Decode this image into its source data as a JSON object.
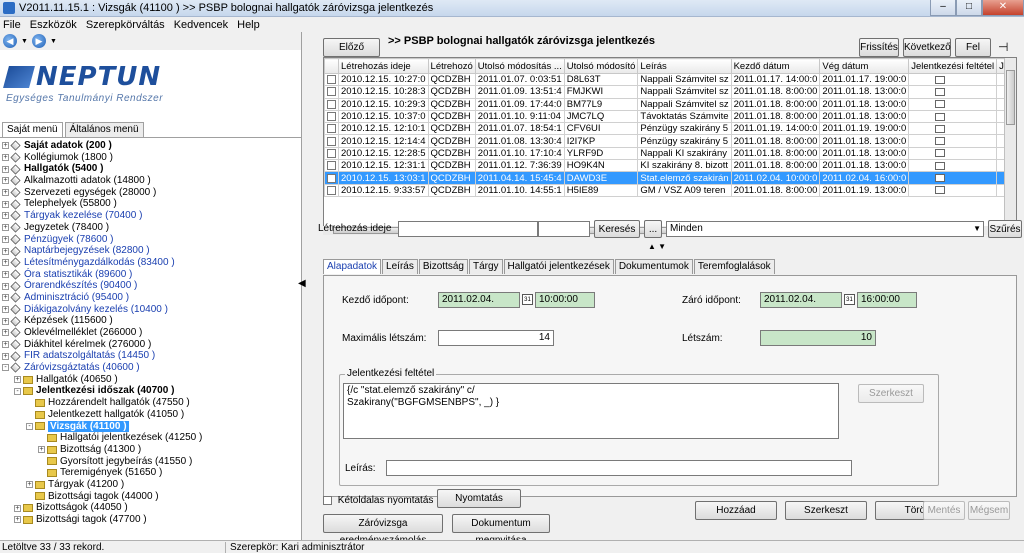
{
  "window": {
    "title": "V2011.11.15.1 : Vizsgák (41100 )  >> PSBP bolognai hallgatók záróvizsga jelentkezés",
    "min": "–",
    "max": "□",
    "close": "✕"
  },
  "menu": [
    "File",
    "Eszközök",
    "Szerepkörváltás",
    "Kedvencek",
    "Help"
  ],
  "logo": {
    "brand": "NEPTUN",
    "subtitle": "Egységes Tanulmányi Rendszer"
  },
  "left_tabs": [
    "Saját menü",
    "Általános menü"
  ],
  "tree": [
    {
      "label": "Saját adatok (200 )",
      "level": 0,
      "style": "bold",
      "toggle": "+"
    },
    {
      "label": "Kollégiumok (1800 )",
      "level": 0,
      "style": "",
      "toggle": "+"
    },
    {
      "label": "Hallgatók (5400 )",
      "level": 0,
      "style": "bold",
      "toggle": "+"
    },
    {
      "label": "Alkalmazotti adatok (14800 )",
      "level": 0,
      "style": "",
      "toggle": "+"
    },
    {
      "label": "Szervezeti egységek (28000 )",
      "level": 0,
      "style": "",
      "toggle": "+"
    },
    {
      "label": "Telephelyek (55800 )",
      "level": 0,
      "style": "",
      "toggle": "+"
    },
    {
      "label": "Tárgyak kezelése (70400 )",
      "level": 0,
      "style": "blue",
      "toggle": "+"
    },
    {
      "label": "Jegyzetek (78400 )",
      "level": 0,
      "style": "",
      "toggle": "+"
    },
    {
      "label": "Pénzügyek (78600 )",
      "level": 0,
      "style": "blue",
      "toggle": "+"
    },
    {
      "label": "Naptárbejegyzések (82800 )",
      "level": 0,
      "style": "blue",
      "toggle": "+"
    },
    {
      "label": "Létesítménygazdálkodás (83400 )",
      "level": 0,
      "style": "blue",
      "toggle": "+"
    },
    {
      "label": "Óra statisztikák (89600 )",
      "level": 0,
      "style": "blue",
      "toggle": "+"
    },
    {
      "label": "Órarendkészítés (90400 )",
      "level": 0,
      "style": "blue",
      "toggle": "+"
    },
    {
      "label": "Adminisztráció (95400 )",
      "level": 0,
      "style": "blue",
      "toggle": "+"
    },
    {
      "label": "Diákigazolvány kezelés (10400 )",
      "level": 0,
      "style": "blue",
      "toggle": "+"
    },
    {
      "label": "Képzések (115600 )",
      "level": 0,
      "style": "",
      "toggle": "+"
    },
    {
      "label": "Oklevélmelléklet (266000 )",
      "level": 0,
      "style": "",
      "toggle": "+"
    },
    {
      "label": "Diákhitel kérelmek (276000 )",
      "level": 0,
      "style": "",
      "toggle": "+"
    },
    {
      "label": "FIR adatszolgáltatás (14450 )",
      "level": 0,
      "style": "blue",
      "toggle": "+"
    },
    {
      "label": "Záróvizsgáztatás (40600 )",
      "level": 0,
      "style": "blue",
      "toggle": "-"
    },
    {
      "label": "Hallgatók (40650 )",
      "level": 1,
      "style": "",
      "toggle": "+",
      "folder": true
    },
    {
      "label": "Jelentkezési időszak (40700 )",
      "level": 1,
      "style": "bold",
      "toggle": "-",
      "folder": true
    },
    {
      "label": "Hozzárendelt hallgatók (47550 )",
      "level": 2,
      "style": "",
      "toggle": "",
      "folder": true
    },
    {
      "label": "Jelentkezett hallgatók (41050 )",
      "level": 2,
      "style": "",
      "toggle": "",
      "folder": true
    },
    {
      "label": "Vizsgák (41100 )",
      "level": 2,
      "style": "selected",
      "toggle": "-",
      "folder": true
    },
    {
      "label": "Hallgatói jelentkezések (41250 )",
      "level": 3,
      "style": "",
      "toggle": "",
      "folder": true
    },
    {
      "label": "Bizottság (41300 )",
      "level": 3,
      "style": "",
      "toggle": "+",
      "folder": true
    },
    {
      "label": "Gyorsított jegybeírás (41550 )",
      "level": 3,
      "style": "",
      "toggle": "",
      "folder": true
    },
    {
      "label": "Teremigények (51650 )",
      "level": 3,
      "style": "",
      "toggle": "",
      "folder": true
    },
    {
      "label": "Tárgyak (41200 )",
      "level": 2,
      "style": "",
      "toggle": "+",
      "folder": true
    },
    {
      "label": "Bizottsági tagok (44000 )",
      "level": 2,
      "style": "",
      "toggle": "",
      "folder": true
    },
    {
      "label": "Bizottságok (44050 )",
      "level": 1,
      "style": "",
      "toggle": "+",
      "folder": true
    },
    {
      "label": "Bizottsági tagok (47700 )",
      "level": 1,
      "style": "",
      "toggle": "+",
      "folder": true
    }
  ],
  "toolbar": {
    "prev": "Előző",
    "title": ">> PSBP bolognai hallgatók záróvizsga jelentkezés",
    "refresh": "Frissítés",
    "next": "Következő",
    "up": "Fel",
    "pin": "⊣"
  },
  "grid": {
    "columns": [
      "",
      "Létrehozás ideje",
      "Létrehozó",
      "Utolsó módosítás ...",
      "Utolsó módosító",
      "Leírás",
      "Kezdő dátum",
      "Vég dátum",
      "Jelentkezési feltétel",
      "Jelentkezési felté"
    ],
    "rows": [
      [
        "2010.12.15. 10:27:0",
        "QCDZBH",
        "2011.01.07. 0:03:51",
        "D8L63T",
        "Nappali Számvitel sz",
        "2011.01.17. 14:00:0",
        "2011.01.17. 19:00:0"
      ],
      [
        "2010.12.15. 10:28:3",
        "QCDZBH",
        "2011.01.09. 13:51:4",
        "FMJKWI",
        "Nappali Számvitel sz",
        "2011.01.18. 8:00:00",
        "2011.01.18. 13:00:0"
      ],
      [
        "2010.12.15. 10:29:3",
        "QCDZBH",
        "2011.01.09. 17:44:0",
        "BM77L9",
        "Nappali Számvitel sz",
        "2011.01.18. 8:00:00",
        "2011.01.18. 13:00:0"
      ],
      [
        "2010.12.15. 10:37:0",
        "QCDZBH",
        "2011.01.10. 9:11:04",
        "JMC7LQ",
        "Távoktatás Számvite",
        "2011.01.18. 8:00:00",
        "2011.01.18. 13:00:0"
      ],
      [
        "2010.12.15. 12:10:1",
        "QCDZBH",
        "2011.01.07. 18:54:1",
        "CFV6UI",
        "Pénzügy szakirány 5",
        "2011.01.19. 14:00:0",
        "2011.01.19. 19:00:0"
      ],
      [
        "2010.12.15. 12:14:4",
        "QCDZBH",
        "2011.01.08. 13:30:4",
        "I2I7KP",
        "Pénzügy szakirány 5",
        "2011.01.18. 8:00:00",
        "2011.01.18. 13:00:0"
      ],
      [
        "2010.12.15. 12:28:5",
        "QCDZBH",
        "2011.01.10. 17:10:4",
        "YLRF9D",
        "Nappali KI szakirány",
        "2011.01.18. 8:00:00",
        "2011.01.18. 13:00:0"
      ],
      [
        "2010.12.15. 12:31:1",
        "QCDZBH",
        "2011.01.12. 7:36:39",
        "HO9K4N",
        "KI szakirány 8. bizott",
        "2011.01.18. 8:00:00",
        "2011.01.18. 13:00:0"
      ],
      [
        "2010.12.15. 13:03:1",
        "QCDZBH",
        "2011.04.14. 15:45:4",
        "DAWD3E",
        "Stat.elemző szakirán",
        "2011.02.04. 10:00:0",
        "2011.02.04. 16:00:0"
      ],
      [
        "2010.12.15. 9:33:57",
        "QCDZBH",
        "2011.01.10. 14:55:1",
        "H5IE89",
        "GM / VSZ A09 teren",
        "2011.01.18. 8:00:00",
        "2011.01.19. 13:00:0"
      ]
    ],
    "selected_index": 8,
    "icon": "document-icon"
  },
  "filter": {
    "label": "Létrehozás ideje",
    "search": "Keresés",
    "more": "...",
    "select_value": "Minden",
    "filter_btn": "Szűrés"
  },
  "detail_tabs": [
    "Alapadatok",
    "Leírás",
    "Bizottság",
    "Tárgy",
    "Hallgatói jelentkezések",
    "Dokumentumok",
    "Teremfoglalások"
  ],
  "detail": {
    "start_label": "Kezdő időpont:",
    "start_date": "2011.02.04.",
    "start_time": "10:00:00",
    "end_label": "Záró időpont:",
    "end_date": "2011.02.04.",
    "end_time": "16:00:00",
    "max_label": "Maximális létszám:",
    "max_value": "14",
    "count_label": "Létszám:",
    "count_value": "10",
    "condition_legend": "Jelentkezési feltétel",
    "condition_text_1": "{/c \"stat.elemző szakirány\" c/",
    "condition_text_2": "Szakirany(\"BGFGMSENBPS\", _) }",
    "edit_condition": "Szerkeszt",
    "desc_label": "Leírás:",
    "desc_value": "",
    "cal_glyph": "31"
  },
  "bottom": {
    "twosided_label": "Kétoldalas nyomtatás",
    "print": "Nyomtatás",
    "zv_results": "Záróvizsga eredményszámolás",
    "doc_open": "Dokumentum megnyitása",
    "add": "Hozzáad",
    "edit": "Szerkeszt",
    "delete": "Töröl",
    "save": "Mentés",
    "cancel": "Mégsem"
  },
  "status": {
    "records": "Letöltve 33 / 33 rekord.",
    "role": "Szerepkör: Kari adminisztrátor"
  }
}
